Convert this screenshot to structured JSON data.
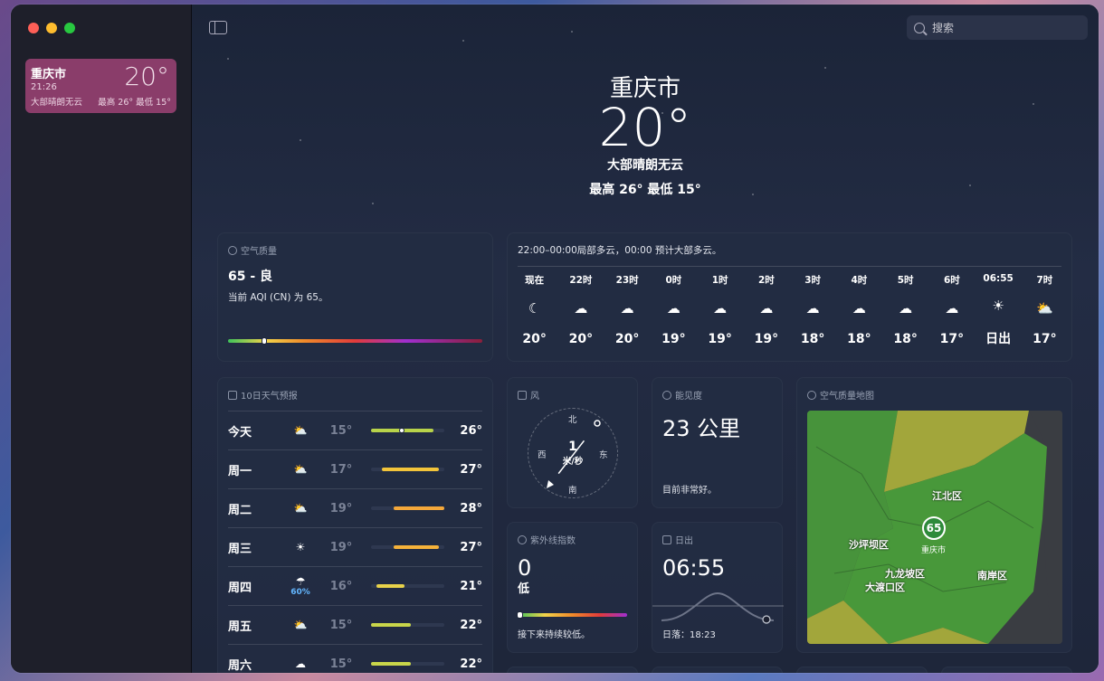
{
  "sidebar": {
    "location": {
      "city": "重庆市",
      "time": "21:26",
      "temp": "20°",
      "condition": "大部晴朗无云",
      "high_low": "最高 26°  最低 15°"
    }
  },
  "search": {
    "placeholder": "搜索"
  },
  "hero": {
    "city": "重庆市",
    "temp": "20°",
    "condition": "大部晴朗无云",
    "high_low": "最高 26°  最低 15°"
  },
  "air_quality": {
    "title": "空气质量",
    "value": "65 - 良",
    "description": "当前 AQI (CN) 为 65。",
    "level_fraction": 0.13
  },
  "hourly": {
    "summary": "22:00–00:00局部多云，00:00 预计大部多云。",
    "items": [
      {
        "time": "现在",
        "icon": "moon-icon",
        "glyph": "☾",
        "temp": "20°"
      },
      {
        "time": "22时",
        "icon": "partly-cloudy-night-icon",
        "glyph": "☁",
        "temp": "20°"
      },
      {
        "time": "23时",
        "icon": "partly-cloudy-night-icon",
        "glyph": "☁",
        "temp": "20°"
      },
      {
        "time": "0时",
        "icon": "cloud-icon",
        "glyph": "☁",
        "temp": "19°"
      },
      {
        "time": "1时",
        "icon": "cloud-icon",
        "glyph": "☁",
        "temp": "19°"
      },
      {
        "time": "2时",
        "icon": "cloud-icon",
        "glyph": "☁",
        "temp": "19°"
      },
      {
        "time": "3时",
        "icon": "cloud-icon",
        "glyph": "☁",
        "temp": "18°"
      },
      {
        "time": "4时",
        "icon": "cloud-icon",
        "glyph": "☁",
        "temp": "18°"
      },
      {
        "time": "5时",
        "icon": "partly-cloudy-night-icon",
        "glyph": "☁",
        "temp": "18°"
      },
      {
        "time": "6时",
        "icon": "cloud-icon",
        "glyph": "☁",
        "temp": "17°"
      },
      {
        "time": "06:55",
        "icon": "sunrise-icon",
        "glyph": "☀",
        "temp": "日出"
      },
      {
        "time": "7时",
        "icon": "partly-sunny-icon",
        "glyph": "⛅",
        "temp": "17°"
      }
    ]
  },
  "daily": {
    "title": "10日天气预报",
    "days": [
      {
        "name": "今天",
        "icon": "partly-sunny-icon",
        "glyph": "⛅",
        "pct": "",
        "low": "15°",
        "high": "26°",
        "lo": 15,
        "hi": 26,
        "color": "#b8d34a",
        "current": true
      },
      {
        "name": "周一",
        "icon": "partly-sunny-icon",
        "glyph": "⛅",
        "pct": "",
        "low": "17°",
        "high": "27°",
        "lo": 17,
        "hi": 27,
        "color": "#f2c43a",
        "current": false
      },
      {
        "name": "周二",
        "icon": "partly-sunny-icon",
        "glyph": "⛅",
        "pct": "",
        "low": "19°",
        "high": "28°",
        "lo": 19,
        "hi": 28,
        "color": "#f5a83a",
        "current": false
      },
      {
        "name": "周三",
        "icon": "sun-icon",
        "glyph": "☀",
        "pct": "",
        "low": "19°",
        "high": "27°",
        "lo": 19,
        "hi": 27,
        "color": "#f5b23a",
        "current": false
      },
      {
        "name": "周四",
        "icon": "rain-icon",
        "glyph": "☂",
        "pct": "60%",
        "low": "16°",
        "high": "21°",
        "lo": 16,
        "hi": 21,
        "color": "#e8d24a",
        "current": false
      },
      {
        "name": "周五",
        "icon": "partly-sunny-icon",
        "glyph": "⛅",
        "pct": "",
        "low": "15°",
        "high": "22°",
        "lo": 15,
        "hi": 22,
        "color": "#c9d64a",
        "current": false
      },
      {
        "name": "周六",
        "icon": "cloud-icon",
        "glyph": "☁",
        "pct": "",
        "low": "15°",
        "high": "22°",
        "lo": 15,
        "hi": 22,
        "color": "#c9d64a",
        "current": false
      }
    ],
    "range_min": 15,
    "range_max": 28
  },
  "wind": {
    "title": "风",
    "speed": "1",
    "unit": "米/秒",
    "north": "北",
    "south": "南",
    "east": "东",
    "west": "西"
  },
  "visibility": {
    "title": "能见度",
    "value": "23 公里",
    "note": "目前非常好。"
  },
  "uv": {
    "title": "紫外线指数",
    "value": "0",
    "level": "低",
    "note": "接下来持续较低。"
  },
  "sunrise": {
    "title": "日出",
    "time": "06:55",
    "sunset": "日落：18:23"
  },
  "aq_map": {
    "title": "空气质量地图",
    "badge": "65",
    "center_label": "重庆市",
    "districts": [
      "江北区",
      "沙坪坝区",
      "九龙坡区",
      "大渡口区",
      "南岸区"
    ]
  }
}
